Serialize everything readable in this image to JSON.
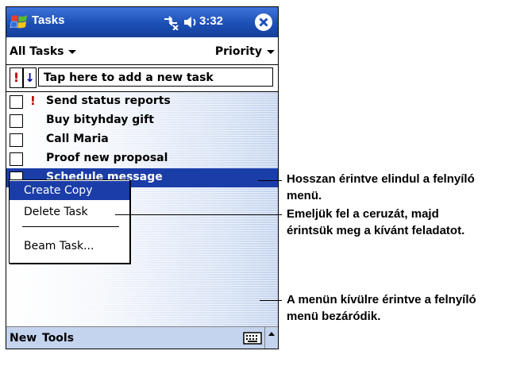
{
  "titlebar": {
    "app_title": "Tasks",
    "clock": "3:32",
    "icons": [
      "windows-start-icon",
      "connectivity-icon",
      "volume-icon",
      "close-icon"
    ]
  },
  "subheader": {
    "filter_label": "All Tasks",
    "sort_label": "Priority"
  },
  "entry_bar": {
    "priority_glyph": "!",
    "sort_glyph": "↓",
    "placeholder": "Tap here to add a new task"
  },
  "tasks": [
    {
      "label": "Send status reports",
      "high_priority": true,
      "priority_glyph": "!"
    },
    {
      "label": "Buy bityhday gift",
      "high_priority": false
    },
    {
      "label": "Call Maria",
      "high_priority": false
    },
    {
      "label": "Proof new proposal",
      "high_priority": false
    },
    {
      "label": "Schedule message",
      "high_priority": false,
      "selected": true
    }
  ],
  "popup_menu": {
    "items": [
      "Create Copy",
      "Delete Task",
      "Beam Task..."
    ],
    "highlighted": "Create Copy"
  },
  "bottombar": {
    "menu_new": "New",
    "menu_tools": "Tools",
    "icons": [
      "keyboard-icon",
      "sip-up-arrow-icon"
    ]
  },
  "callouts": [
    {
      "line1": "Hosszan érintve elindul a felnyíló",
      "line2": "menü."
    },
    {
      "line1": "Emeljük fel a ceruzát, majd",
      "line2": "érintsük meg a kívánt feladatot."
    },
    {
      "line1": "A menün kívülre érintve a felnyíló",
      "line2": "menü bezáródik."
    }
  ],
  "colors": {
    "titlebar": "#1c4fb6",
    "selection": "#1a3da8",
    "priority_red": "#c00000"
  }
}
